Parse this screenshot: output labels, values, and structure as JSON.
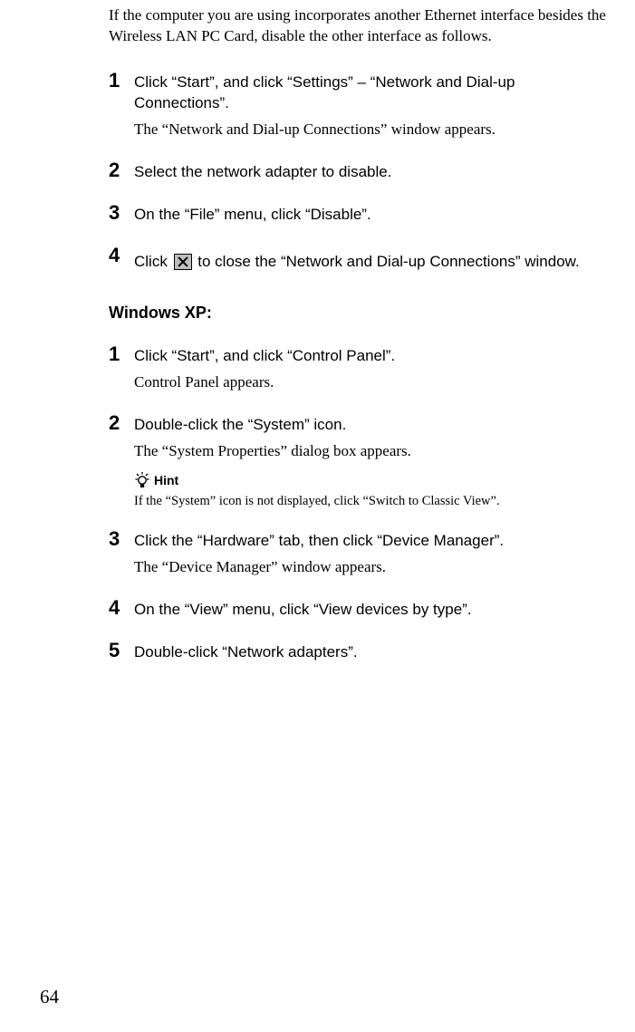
{
  "intro": "If the computer you are using incorporates another Ethernet interface besides the Wireless LAN PC Card, disable the other interface as follows.",
  "stepsA": [
    {
      "num": "1",
      "instruction": "Click “Start”, and click “Settings” – “Network and Dial-up Connections”.",
      "result": "The “Network and Dial-up Connections” window appears."
    },
    {
      "num": "2",
      "instruction": "Select the network adapter to disable."
    },
    {
      "num": "3",
      "instruction": "On the “File” menu, click “Disable”."
    }
  ],
  "step4": {
    "num": "4",
    "before": "Click ",
    "after": " to close the “Network and Dial-up Connections” window."
  },
  "heading": "Windows XP:",
  "stepsB": [
    {
      "num": "1",
      "instruction": "Click “Start”, and click “Control Panel”.",
      "result": "Control Panel appears."
    },
    {
      "num": "2",
      "instruction": "Double-click the “System” icon.",
      "result": "The “System Properties” dialog box appears.",
      "hintLabel": "Hint",
      "hintText": "If the “System” icon is not displayed, click “Switch to Classic View”."
    },
    {
      "num": "3",
      "instruction": "Click the “Hardware” tab, then click “Device Manager”.",
      "result": "The “Device Manager” window appears."
    },
    {
      "num": "4",
      "instruction": "On the “View” menu, click “View devices by type”."
    },
    {
      "num": "5",
      "instruction": "Double-click “Network adapters”."
    }
  ],
  "pageNumber": "64"
}
